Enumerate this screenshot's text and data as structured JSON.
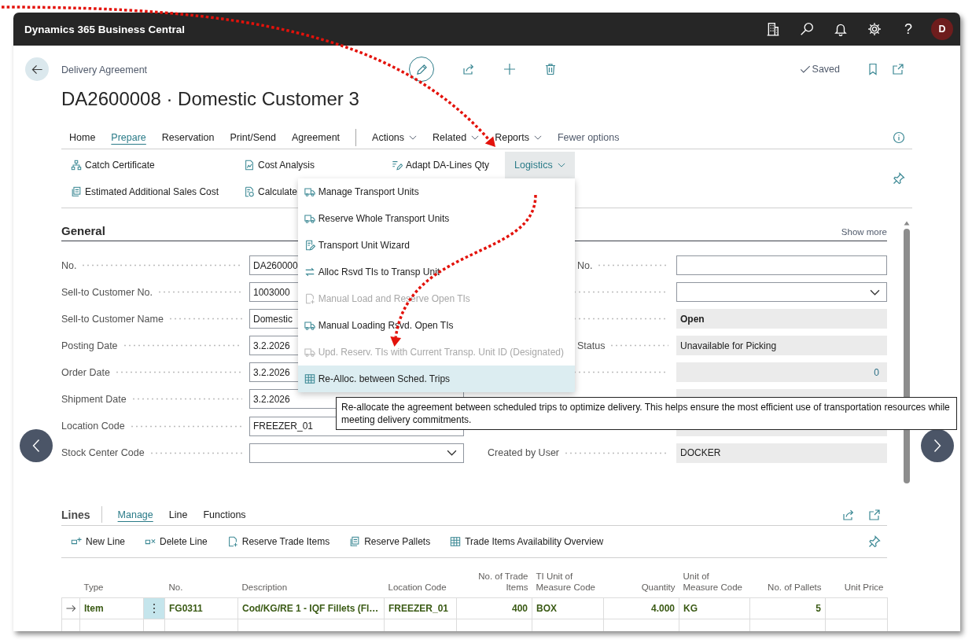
{
  "top_bar": {
    "app_name": "Dynamics 365 Business Central",
    "help_symbol": "?",
    "avatar_initial": "D"
  },
  "header": {
    "breadcrumb": "Delivery Agreement",
    "title": "DA2600008 · Domestic Customer 3",
    "save_status": "Saved"
  },
  "action_tabs": [
    {
      "label": "Home",
      "kind": "tab",
      "selected": false
    },
    {
      "label": "Prepare",
      "kind": "tab",
      "selected": true
    },
    {
      "label": "Reservation",
      "kind": "tab",
      "selected": false
    },
    {
      "label": "Print/Send",
      "kind": "tab",
      "selected": false
    },
    {
      "label": "Agreement",
      "kind": "tab",
      "selected": false
    },
    {
      "label": "Actions",
      "kind": "menu",
      "selected": false
    },
    {
      "label": "Related",
      "kind": "menu",
      "selected": false
    },
    {
      "label": "Reports",
      "kind": "menu",
      "selected": false
    },
    {
      "label": "Fewer options",
      "kind": "toggle",
      "selected": false
    }
  ],
  "actions": [
    {
      "label": "Catch Certificate",
      "kind": "action"
    },
    {
      "label": "Cost Analysis",
      "kind": "action"
    },
    {
      "label": "Adapt DA-Lines Qty",
      "kind": "action"
    },
    {
      "label": "Logistics",
      "kind": "menu",
      "expanded": true
    },
    {
      "label": "Estimated Additional Sales Cost",
      "kind": "action"
    },
    {
      "label": "Calculate",
      "kind": "action"
    }
  ],
  "logistics_menu": [
    {
      "label": "Manage Transport Units",
      "disabled": false,
      "selected": false
    },
    {
      "label": "Reserve Whole Transport Units",
      "disabled": false,
      "selected": false
    },
    {
      "label": "Transport Unit Wizard",
      "disabled": false,
      "selected": false
    },
    {
      "label": "Alloc Rsvd TIs to Transp Unit",
      "disabled": false,
      "selected": false
    },
    {
      "label": "Manual Load and Reserve Open TIs",
      "disabled": true,
      "selected": false
    },
    {
      "label": "Manual Loading Rsvd. Open TIs",
      "disabled": false,
      "selected": false
    },
    {
      "label": "Upd. Reserv. TIs with Current Transp. Unit ID (Designated)",
      "disabled": true,
      "selected": false
    },
    {
      "label": "Re-Alloc. between Sched. Trips",
      "disabled": false,
      "selected": true
    }
  ],
  "tooltip": "Re-allocate the agreement between scheduled trips to optimize delivery. This helps ensure the most efficient use of transportation resources while meeting delivery commitments.",
  "general": {
    "title": "General",
    "show_more": "Show more",
    "left_fields": [
      {
        "label": "No.",
        "value": "DA260000",
        "kind": "input"
      },
      {
        "label": "Sell-to Customer No.",
        "value": "1003000",
        "kind": "input"
      },
      {
        "label": "Sell-to Customer Name",
        "value": "Domestic",
        "kind": "input"
      },
      {
        "label": "Posting Date",
        "value": "3.2.2026",
        "kind": "input"
      },
      {
        "label": "Order Date",
        "value": "3.2.2026",
        "kind": "input"
      },
      {
        "label": "Shipment Date",
        "value": "3.2.2026",
        "kind": "input"
      },
      {
        "label": "Location Code",
        "value": "FREEZER_01",
        "kind": "input"
      },
      {
        "label": "Stock Center Code",
        "kind": "dropdown"
      }
    ],
    "right_fields": [
      {
        "label": "No.",
        "label_start_hidden": true,
        "kind": "input"
      },
      {
        "kind": "dropdown"
      },
      {
        "value": "Open",
        "kind": "display",
        "emphasized": true
      },
      {
        "label": "Status",
        "label_start_hidden": true,
        "value": "Unavailable for Picking",
        "kind": "display",
        "emphasized": false
      },
      {
        "value": "0",
        "kind": "drilldown"
      },
      {
        "kind": "display"
      },
      {
        "kind": "display"
      },
      {
        "label": "Created by User",
        "value": "DOCKER",
        "kind": "display",
        "emphasized": false
      }
    ]
  },
  "lines": {
    "title": "Lines",
    "tabs": [
      {
        "label": "Manage",
        "selected": true
      },
      {
        "label": "Line",
        "selected": false
      },
      {
        "label": "Functions",
        "selected": false
      }
    ],
    "actions": [
      "New Line",
      "Delete Line",
      "Reserve Trade Items",
      "Reserve Pallets",
      "Trade Items Availability Overview"
    ],
    "table": {
      "columns": [
        {
          "label": "Type",
          "kind": "text"
        },
        {
          "label": "No.",
          "kind": "text"
        },
        {
          "label": "Description",
          "kind": "text"
        },
        {
          "label": "Location Code",
          "kind": "text"
        },
        {
          "label": "No. of Trade Items",
          "kind": "number"
        },
        {
          "label": "TI Unit of Measure Code",
          "kind": "text"
        },
        {
          "label": "Quantity",
          "kind": "number"
        },
        {
          "label": "Unit of Measure Code",
          "kind": "text"
        },
        {
          "label": "No. of Pallets",
          "kind": "number"
        },
        {
          "label": "Unit Price",
          "kind": "number"
        }
      ],
      "rows": [
        {
          "current": true,
          "cells": [
            "Item",
            "FG0311",
            "Cod/KG/RE 1 - IQF Fillets (Fl…",
            "FREEZER_01",
            "400",
            "BOX",
            "4.000",
            "KG",
            "5"
          ]
        },
        {
          "current": false
        }
      ]
    }
  }
}
